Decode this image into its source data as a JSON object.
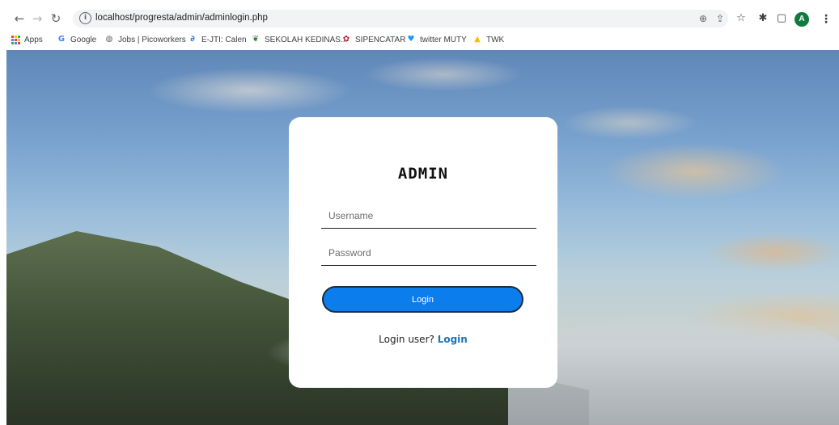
{
  "browser": {
    "url": "localhost/progresta/admin/adminlogin.php",
    "profile_initial": "A",
    "bookmarks": [
      {
        "label": "Apps",
        "icon": "apps-grid-icon"
      },
      {
        "label": "Google",
        "icon": "google-icon",
        "color": "#4285f4"
      },
      {
        "label": "Jobs | Picoworkers",
        "icon": "globe-icon",
        "color": "#5f6368"
      },
      {
        "label": "E-JTI: Calen",
        "icon": "ejti-icon",
        "color": "#1a73e8"
      },
      {
        "label": "SEKOLAH KEDINAS...",
        "icon": "book-icon",
        "color": "#2e7d32"
      },
      {
        "label": "SIPENCATAR",
        "icon": "emblem-icon",
        "color": "#b71c1c"
      },
      {
        "label": "twitter MUTY",
        "icon": "twitter-icon",
        "color": "#1d9bf0"
      },
      {
        "label": "TWK",
        "icon": "drive-icon",
        "color": "#fbbc04"
      }
    ]
  },
  "login": {
    "title": "ADMIN",
    "username_placeholder": "Username",
    "password_placeholder": "Password",
    "button_label": "Login",
    "user_prompt": "Login user?",
    "user_link": "Login"
  },
  "colors": {
    "button": "#0b7ded",
    "link": "#1a73b8"
  }
}
